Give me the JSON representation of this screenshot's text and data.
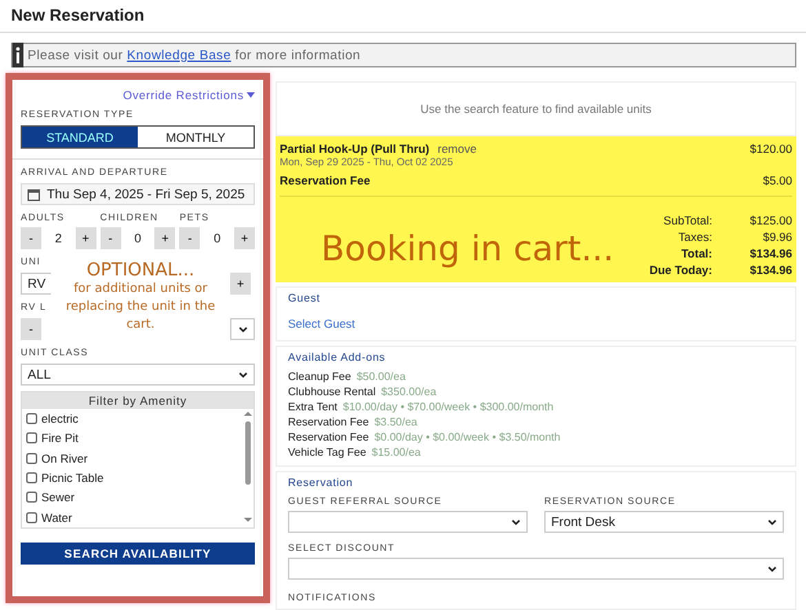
{
  "page_title": "New Reservation",
  "info_bar": {
    "before": "Please visit our",
    "link": "Knowledge Base",
    "after": "for more information"
  },
  "search_panel": {
    "override_link": "Override Restrictions",
    "reservation_type": {
      "label": "RESERVATION TYPE",
      "options": [
        {
          "label": "STANDARD",
          "selected": true
        },
        {
          "label": "MONTHLY",
          "selected": false
        }
      ]
    },
    "dates": {
      "label": "ARRIVAL AND DEPARTURE",
      "value": "Thu Sep 4, 2025 - Fri Sep 5, 2025"
    },
    "counters": [
      {
        "label": "ADULTS",
        "value": "2",
        "minus": "-",
        "plus": "+"
      },
      {
        "label": "CHILDREN",
        "value": "0",
        "minus": "-",
        "plus": "+"
      },
      {
        "label": "PETS",
        "value": "0",
        "minus": "-",
        "plus": "+"
      }
    ],
    "unit": {
      "label": "UNI",
      "value": "RV",
      "plus": "+"
    },
    "rv_length": {
      "label": "RV L",
      "minus": "-"
    },
    "unit_class": {
      "label": "UNIT CLASS",
      "value": "ALL"
    },
    "amenities": {
      "title": "Filter by Amenity",
      "items": [
        {
          "label": "electric",
          "checked": false
        },
        {
          "label": "Fire Pit",
          "checked": false
        },
        {
          "label": "On River",
          "checked": false
        },
        {
          "label": "Picnic Table",
          "checked": false
        },
        {
          "label": "Sewer",
          "checked": false
        },
        {
          "label": "Water",
          "checked": false
        }
      ]
    },
    "search_button": "SEARCH AVAILABILITY",
    "note": {
      "title": "OPTIONAL...",
      "text": "for additional units or replacing the unit in the cart."
    }
  },
  "results_hint": "Use the search feature to find available units",
  "cart": {
    "items": [
      {
        "name": "Partial Hook-Up (Pull Thru)",
        "action": "remove",
        "dates": "Mon, Sep 29 2025 - Thu, Oct 02 2025",
        "price": "$120.00"
      },
      {
        "name": "Reservation Fee",
        "price": "$5.00"
      }
    ],
    "totals": [
      {
        "label": "SubTotal:",
        "value": "$125.00",
        "bold": false
      },
      {
        "label": "Taxes:",
        "value": "$9.96",
        "bold": false
      },
      {
        "label": "Total:",
        "value": "$134.96",
        "bold": true
      },
      {
        "label": "Due Today:",
        "value": "$134.96",
        "bold": true
      }
    ],
    "note": "Booking in cart..."
  },
  "guest": {
    "title": "Guest",
    "link": "Select Guest"
  },
  "addons": {
    "title": "Available Add-ons",
    "items": [
      {
        "name": "Cleanup Fee",
        "rates": "$50.00/ea"
      },
      {
        "name": "Clubhouse Rental",
        "rates": "$350.00/ea"
      },
      {
        "name": "Extra Tent",
        "rates": "$10.00/day • $70.00/week • $300.00/month"
      },
      {
        "name": "Reservation Fee",
        "rates": "$3.50/ea"
      },
      {
        "name": "Reservation Fee",
        "rates": "$0.00/day • $0.00/week • $3.50/month"
      },
      {
        "name": "Vehicle Tag Fee",
        "rates": "$15.00/ea"
      }
    ]
  },
  "reservation": {
    "title": "Reservation",
    "fields": [
      {
        "label": "GUEST REFERRAL SOURCE",
        "wide": false
      },
      {
        "label": "RESERVATION SOURCE",
        "value": "Front Desk",
        "wide": false
      },
      {
        "label": "SELECT DISCOUNT",
        "wide": true
      }
    ],
    "notifications_label": "NOTIFICATIONS"
  }
}
